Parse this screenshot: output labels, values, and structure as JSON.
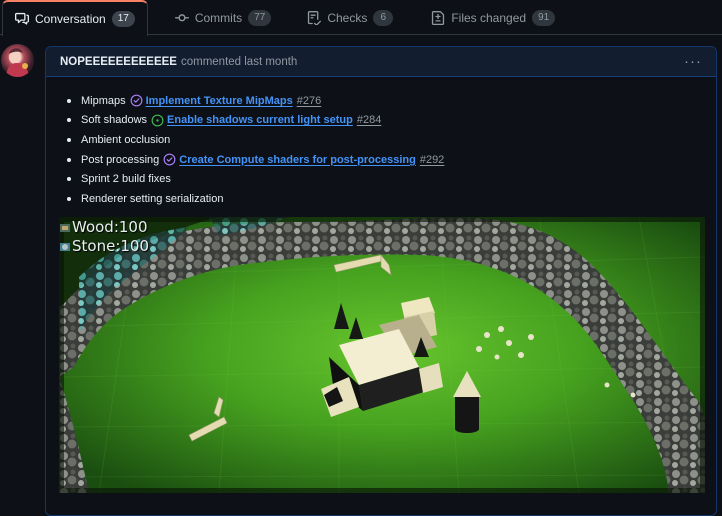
{
  "tabs": [
    {
      "label": "Conversation",
      "count": "17",
      "icon": "conversation-icon"
    },
    {
      "label": "Commits",
      "count": "77",
      "icon": "commit-icon"
    },
    {
      "label": "Checks",
      "count": "6",
      "icon": "checks-icon"
    },
    {
      "label": "Files changed",
      "count": "91",
      "icon": "file-diff-icon"
    }
  ],
  "comment": {
    "author": "NOPEEEEEEEEEEEE",
    "action": "commented last month",
    "menu": "···",
    "items": [
      {
        "label": "Mipmaps",
        "issue_title": "Implement Texture MipMaps",
        "issue_number": "#276",
        "status": "closed"
      },
      {
        "label": "Soft shadows",
        "issue_title": "Enable shadows current light setup",
        "issue_number": "#284",
        "status": "open"
      },
      {
        "label": "Ambient occlusion"
      },
      {
        "label": "Post processing",
        "issue_title": "Create Compute shaders for post-processing",
        "issue_number": "#292",
        "status": "closed"
      },
      {
        "label": "Sprint 2 build fixes"
      },
      {
        "label": "Renderer setting serialization"
      }
    ]
  },
  "game": {
    "resources": [
      {
        "label": "Wood:100",
        "icon": "wood-icon"
      },
      {
        "label": "Stone:100",
        "icon": "stone-icon"
      }
    ]
  },
  "colors": {
    "accent": "#f78166",
    "link": "#4493f8",
    "closed_issue": "#ab7df8",
    "open_issue": "#3fb950",
    "grass": "#3d9a1c"
  }
}
